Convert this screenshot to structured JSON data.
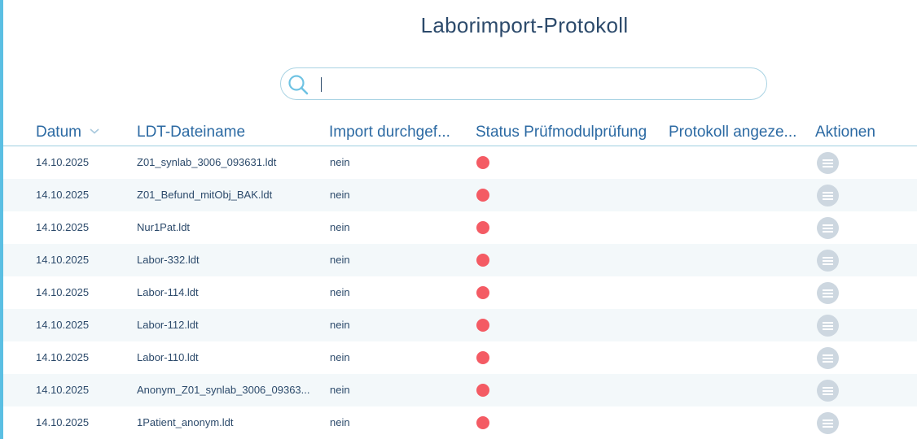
{
  "page": {
    "title": "Laborimport-Protokoll"
  },
  "search": {
    "placeholder": "",
    "value": ""
  },
  "table": {
    "columns": {
      "datum": "Datum",
      "dateiname": "LDT-Dateiname",
      "import": "Import durchgef...",
      "status": "Status Prüfmodulprüfung",
      "protokoll": "Protokoll angeze...",
      "aktionen": "Aktionen"
    },
    "sort": {
      "column": "Datum",
      "icon": "chevron-down-icon"
    },
    "status_color": "#f45b64",
    "rows": [
      {
        "datum": "14.10.2025",
        "dateiname": "Z01_synlab_3006_093631.ldt",
        "import": "nein",
        "status": "red"
      },
      {
        "datum": "14.10.2025",
        "dateiname": "Z01_Befund_mitObj_BAK.ldt",
        "import": "nein",
        "status": "red"
      },
      {
        "datum": "14.10.2025",
        "dateiname": "Nur1Pat.ldt",
        "import": "nein",
        "status": "red"
      },
      {
        "datum": "14.10.2025",
        "dateiname": "Labor-332.ldt",
        "import": "nein",
        "status": "red"
      },
      {
        "datum": "14.10.2025",
        "dateiname": "Labor-114.ldt",
        "import": "nein",
        "status": "red"
      },
      {
        "datum": "14.10.2025",
        "dateiname": "Labor-112.ldt",
        "import": "nein",
        "status": "red"
      },
      {
        "datum": "14.10.2025",
        "dateiname": "Labor-110.ldt",
        "import": "nein",
        "status": "red"
      },
      {
        "datum": "14.10.2025",
        "dateiname": "Anonym_Z01_synlab_3006_09363...",
        "import": "nein",
        "status": "red"
      },
      {
        "datum": "14.10.2025",
        "dateiname": "1Patient_anonym.ldt",
        "import": "nein",
        "status": "red"
      }
    ]
  },
  "colors": {
    "accent": "#5bbfe3",
    "header_text": "#2c6aa3",
    "body_text": "#2c4a6b",
    "row_alt": "#f3f8fa",
    "action_button": "#cdd7e0"
  }
}
